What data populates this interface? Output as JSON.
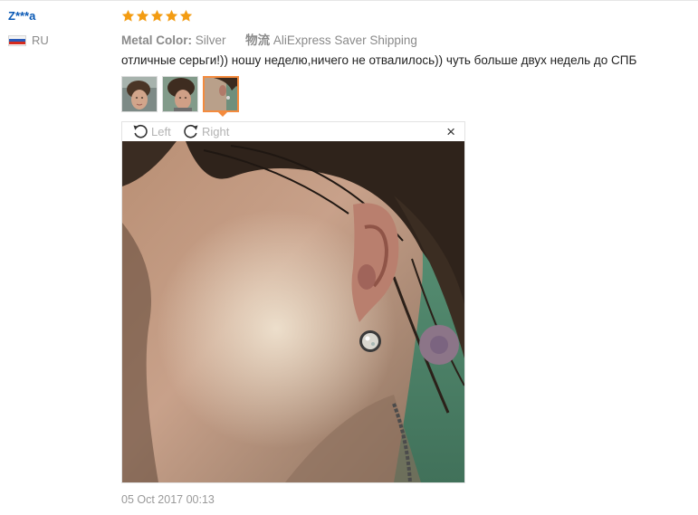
{
  "review": {
    "user_name": "Z***a",
    "country": "RU",
    "rating": 5,
    "attributes": {
      "color_label": "Metal Color:",
      "color_value": "Silver",
      "shipping_label": "物流",
      "shipping_value": "AliExpress Saver Shipping"
    },
    "text": "отличные серьги!)) ношу неделю,ничего не отвалилось)) чуть больше двух недель до СПБ",
    "photo_count": 3,
    "active_photo_index": 2,
    "date": "05 Oct 2017 00:13"
  },
  "viewer": {
    "rotate_left_label": "Left",
    "rotate_right_label": "Right",
    "close_symbol": "×"
  },
  "icons": {
    "star": "star-icon",
    "rotate_left": "rotate-left-icon",
    "rotate_right": "rotate-right-icon",
    "close": "close-icon",
    "flag": "russia-flag-icon"
  },
  "colors": {
    "username": "#0a59b5",
    "star": "#f39c12",
    "active_thumb_border": "#f48b3e",
    "muted_text": "#8a8a8a"
  }
}
